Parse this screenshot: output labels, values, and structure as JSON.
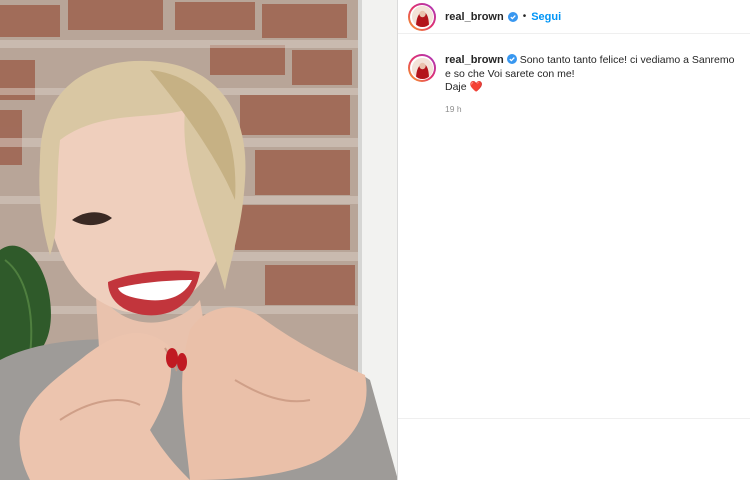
{
  "post": {
    "username": "real_brown",
    "follow_label": "Segui",
    "separator": "•",
    "caption_text": "Sono tanto tanto felice! ci vediamo a Sanremo e so che Voi sarete con me!",
    "caption_line2": "Daje",
    "heart_emoji": "❤️",
    "timestamp": "19 h"
  },
  "icons": {
    "verified": "verified-badge-icon",
    "heart": "red-heart-emoji"
  },
  "colors": {
    "link_blue": "#0095f6",
    "verified_blue": "#3897f0",
    "text": "#262626",
    "muted": "#8e8e8e",
    "heart_red": "#ed1c24"
  }
}
